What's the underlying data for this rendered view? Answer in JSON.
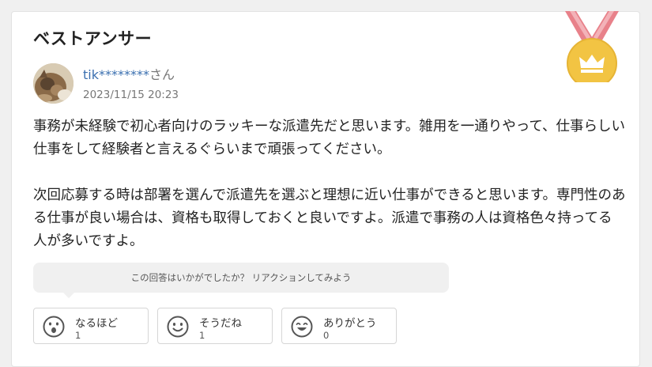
{
  "section_title": "ベストアンサー",
  "answer": {
    "username": "tik********",
    "username_suffix": "さん",
    "date": "2023/11/15 20:23",
    "paragraphs": [
      "事務が未経験で初心者向けのラッキーな派遣先だと思います。雑用を一通りやって、仕事らしい仕事をして経験者と言えるぐらいまで頑張ってください。",
      "次回応募する時は部署を選んで派遣先を選ぶと理想に近い仕事ができると思います。専門性のある仕事が良い場合は、資格も取得しておくと良いですよ。派遣で事務の人は資格色々持ってる人が多いですよ。"
    ]
  },
  "reaction_prompt": "この回答はいかがでしたか？ リアクションしてみよう",
  "reactions": [
    {
      "label": "なるほど",
      "count": "1",
      "icon": "surprised-face-icon"
    },
    {
      "label": "そうだね",
      "count": "1",
      "icon": "smile-face-icon"
    },
    {
      "label": "ありがとう",
      "count": "0",
      "icon": "grin-face-icon"
    }
  ],
  "colors": {
    "username": "#3a6fb0",
    "medal_gold": "#f2c443",
    "ribbon": "#e8818a"
  }
}
